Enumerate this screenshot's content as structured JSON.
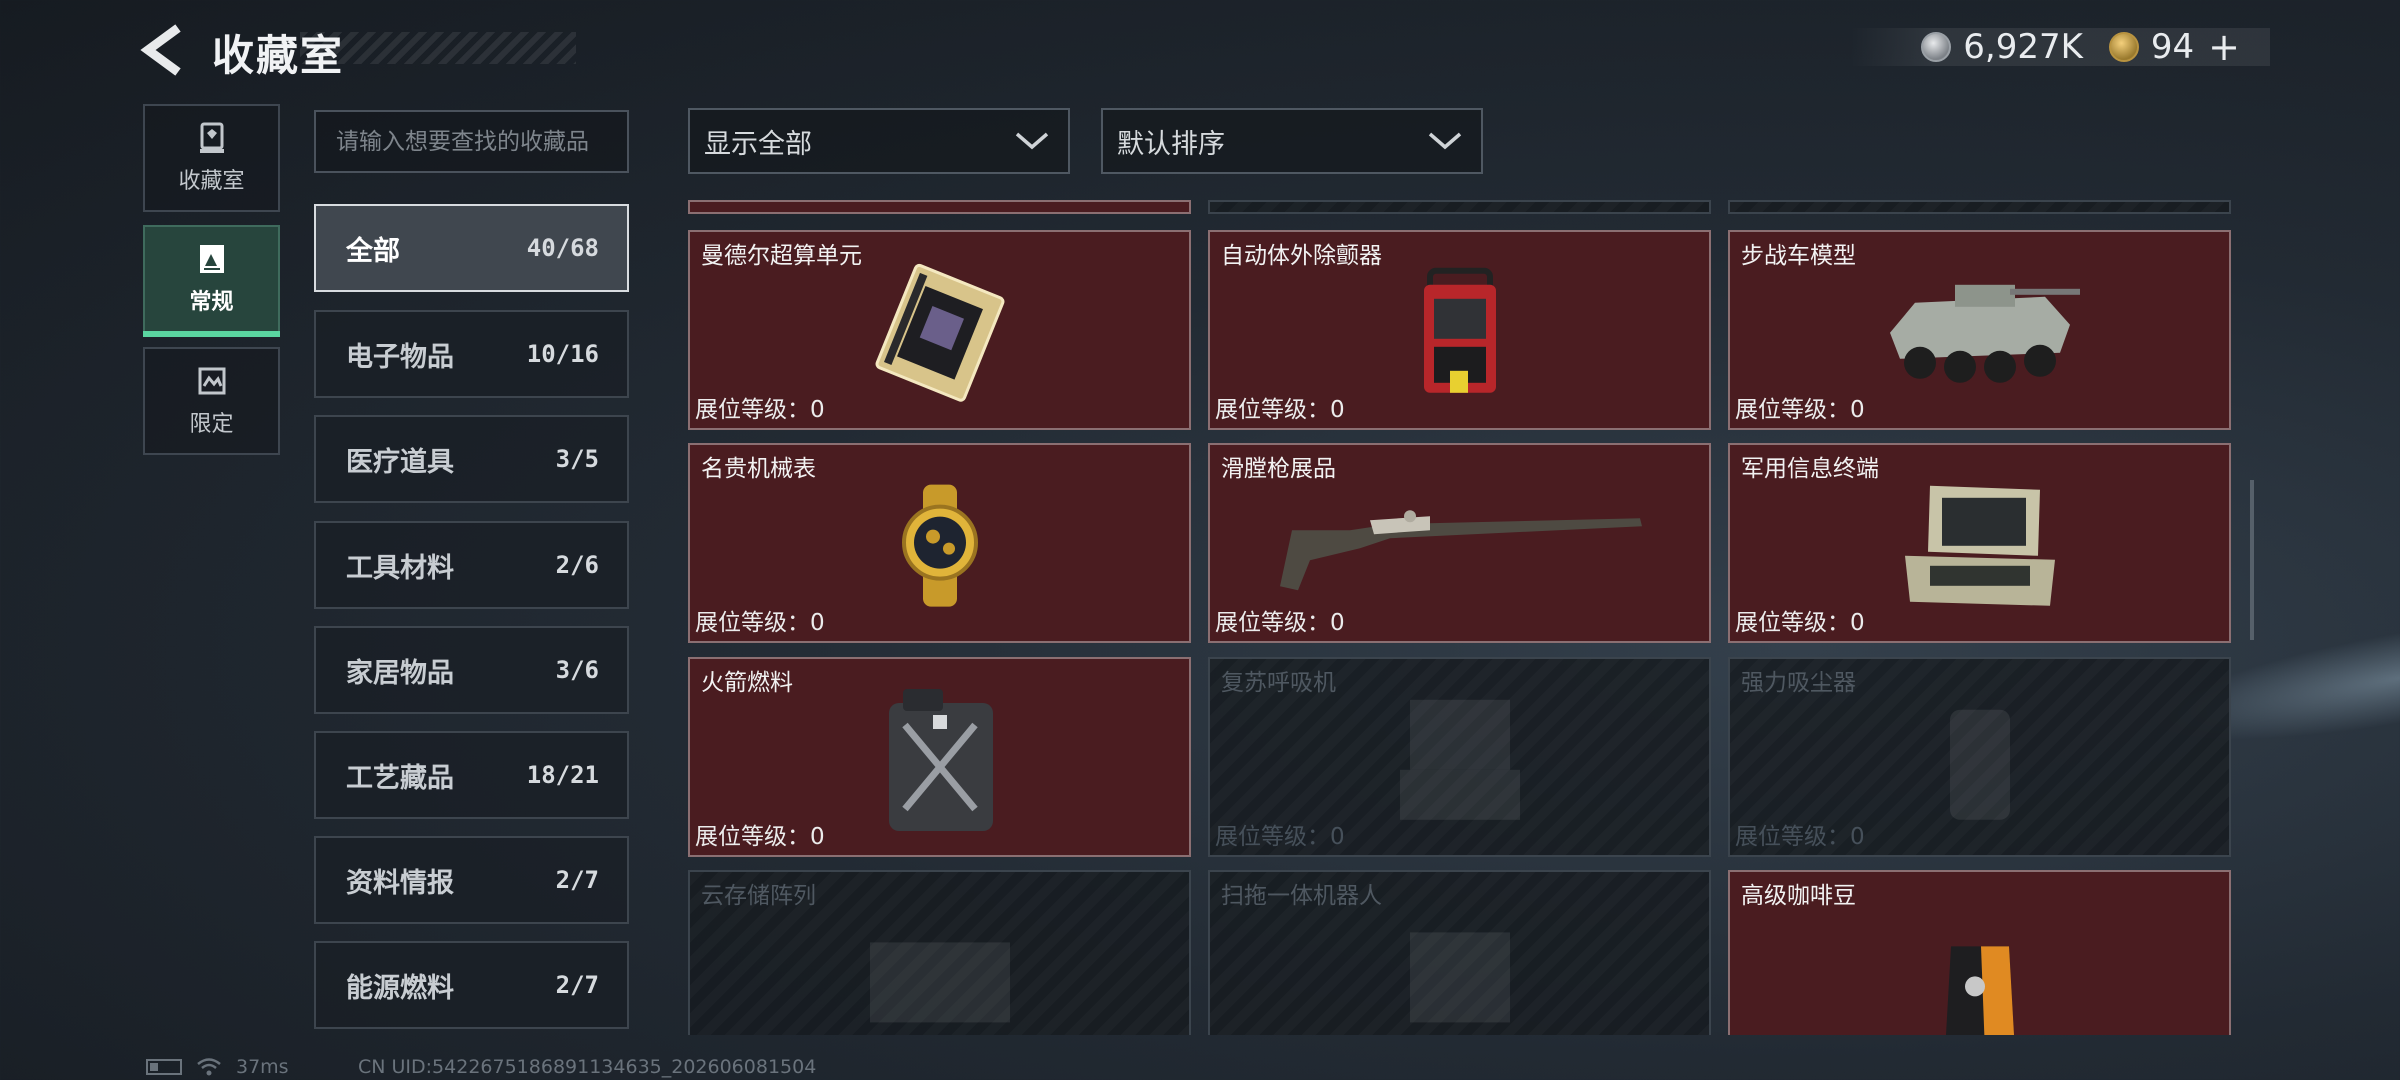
{
  "header": {
    "title": "收藏室",
    "currency_1": "6,927K",
    "currency_2": "94",
    "add_symbol": "+"
  },
  "side_tabs": [
    {
      "label": "收藏室",
      "icon": "trophy-icon"
    },
    {
      "label": "常规",
      "icon": "document-icon",
      "active": true
    },
    {
      "label": "限定",
      "icon": "limited-icon"
    }
  ],
  "search": {
    "placeholder": "请输入想要查找的收藏品"
  },
  "categories": [
    {
      "name": "全部",
      "count": "40/68",
      "active": true
    },
    {
      "name": "电子物品",
      "count": "10/16"
    },
    {
      "name": "医疗道具",
      "count": "3/5"
    },
    {
      "name": "工具材料",
      "count": "2/6"
    },
    {
      "name": "家居物品",
      "count": "3/6"
    },
    {
      "name": "工艺藏品",
      "count": "18/21"
    },
    {
      "name": "资料情报",
      "count": "2/7"
    },
    {
      "name": "能源燃料",
      "count": "2/7"
    }
  ],
  "filters": {
    "filter_value": "显示全部",
    "sort_value": "默认排序"
  },
  "grid": {
    "level_label": "展位等级：",
    "items": [
      {
        "name": "曼德尔超算单元",
        "level": "0",
        "unlocked": true,
        "icon": "supercomputer-unit-icon"
      },
      {
        "name": "自动体外除颤器",
        "level": "0",
        "unlocked": true,
        "icon": "defibrillator-icon"
      },
      {
        "name": "步战车模型",
        "level": "0",
        "unlocked": true,
        "icon": "ifv-model-icon"
      },
      {
        "name": "名贵机械表",
        "level": "0",
        "unlocked": true,
        "icon": "watch-icon"
      },
      {
        "name": "滑膛枪展品",
        "level": "0",
        "unlocked": true,
        "icon": "musket-icon"
      },
      {
        "name": "军用信息终端",
        "level": "0",
        "unlocked": true,
        "icon": "military-terminal-icon"
      },
      {
        "name": "火箭燃料",
        "level": "0",
        "unlocked": true,
        "icon": "fuel-can-icon"
      },
      {
        "name": "复苏呼吸机",
        "level": "0",
        "unlocked": false,
        "icon": "ventilator-icon"
      },
      {
        "name": "强力吸尘器",
        "level": "0",
        "unlocked": false,
        "icon": "vacuum-icon"
      },
      {
        "name": "云存储阵列",
        "level": "",
        "unlocked": false,
        "icon": "storage-array-icon"
      },
      {
        "name": "扫拖一体机器人",
        "level": "",
        "unlocked": false,
        "icon": "robot-icon"
      },
      {
        "name": "高级咖啡豆",
        "level": "",
        "unlocked": true,
        "icon": "coffee-bag-icon"
      }
    ]
  },
  "footer": {
    "ping": "37ms",
    "uid": "CN UID:5422675186891134635_202606081504"
  },
  "colors": {
    "unlocked_card": "#4a1c20",
    "accent_green": "#5ad5a0"
  }
}
